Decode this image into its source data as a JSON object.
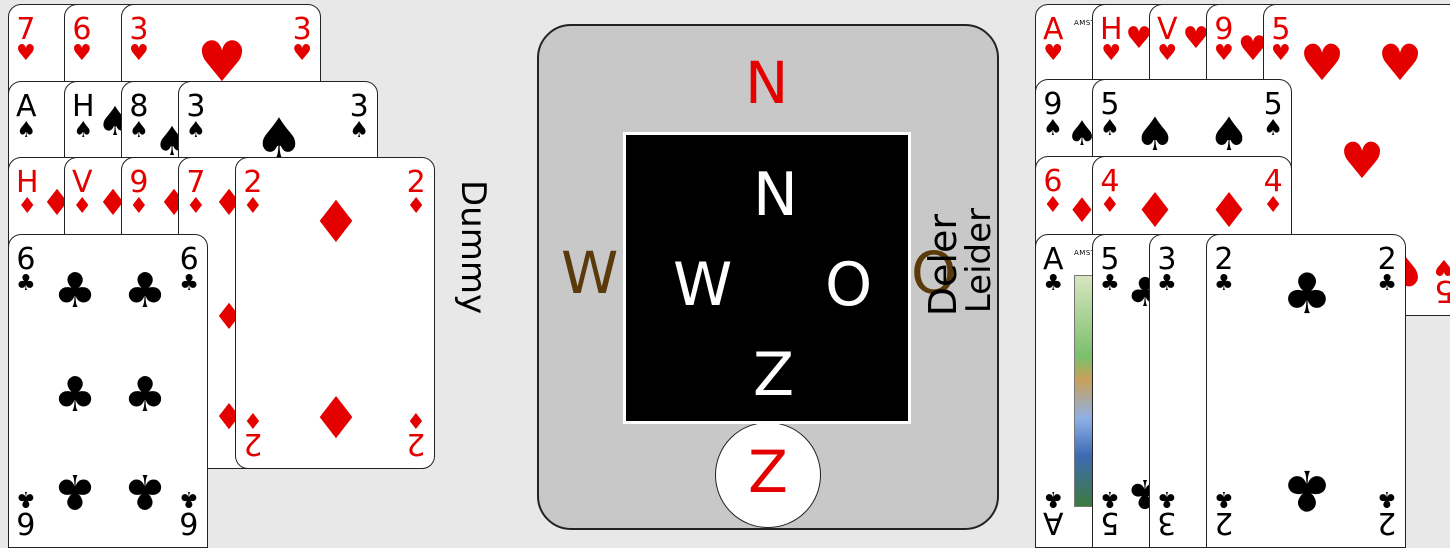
{
  "dummy_label": "Dummy",
  "board": {
    "north": "N",
    "west": "W",
    "east": "O",
    "south": "Z",
    "compass": {
      "n": "N",
      "w": "W",
      "o": "O",
      "z": "Z"
    }
  },
  "roles": {
    "dealer": "Deler",
    "declarer": "Leider"
  },
  "colors": {
    "red": "#e50000",
    "black": "#000000",
    "table": "#e8e8e8",
    "board": "#c8c8c8"
  },
  "suits": {
    "hearts": "♥",
    "spades": "♠",
    "diamonds": "♦",
    "clubs": "♣"
  },
  "dummy_hand": {
    "hearts": [
      "7",
      "6",
      "3"
    ],
    "spades": [
      "A",
      "H",
      "8",
      "3"
    ],
    "diamonds": [
      "H",
      "V",
      "9",
      "7",
      "2"
    ],
    "clubs": [
      "6"
    ]
  },
  "own_hand": {
    "hearts": [
      "A",
      "H",
      "V",
      "9",
      "5"
    ],
    "spades": [
      "9",
      "5"
    ],
    "diamonds": [
      "6",
      "4"
    ],
    "clubs": [
      "A",
      "5",
      "3",
      "2"
    ]
  },
  "card_brand": "AMSTERDAM"
}
